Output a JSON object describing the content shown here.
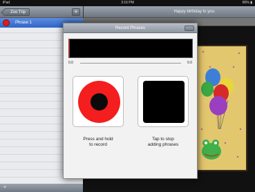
{
  "status_bar": {
    "carrier": "iPad",
    "time": "3:16 PM",
    "battery": "80% ▮"
  },
  "left_panel": {
    "back_label": "Zoo Trip",
    "add_icon": "plus-icon",
    "phrases": [
      {
        "label": "Phrase 1",
        "color": "#d8201a",
        "selected": true
      }
    ],
    "bottom_icon": "plus-icon"
  },
  "right_panel": {
    "title": "Happy birthday to you.",
    "card_background": "#e3c76e"
  },
  "dialog": {
    "title": "Record Phrases",
    "close_icon": "close-icon",
    "time_start": "0.0",
    "time_end": "0.0",
    "record_icon": "record-icon",
    "stop_icon": "stop-icon",
    "record_caption_line1": "Press and hold",
    "record_caption_line2": "to record",
    "stop_caption_line1": "Tap to stop",
    "stop_caption_line2": "adding phrases",
    "colors": {
      "record_ring": "#f41e1e",
      "record_center": "#0a0a0a",
      "stop_square": "#000000",
      "waveform_bg": "#000000"
    }
  }
}
